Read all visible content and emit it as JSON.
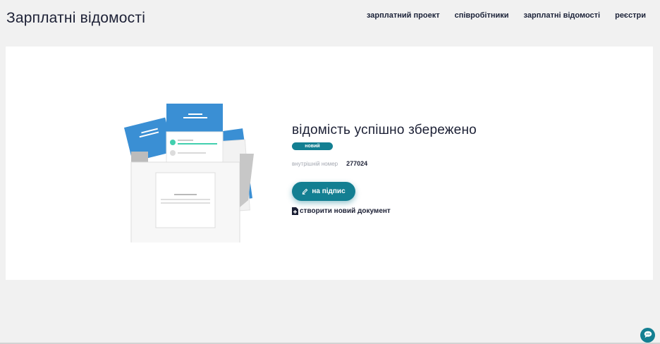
{
  "header": {
    "title": "Зарплатні відомості",
    "nav": [
      {
        "label": "зарплатний проект"
      },
      {
        "label": "співробітники"
      },
      {
        "label": "зарплатні відомості"
      },
      {
        "label": "реєстри"
      }
    ]
  },
  "main": {
    "success_title": "відомість успішно збережено",
    "status_badge": "новий",
    "internal_number_label": "внутрішній номер",
    "internal_number_value": "277024",
    "sign_button_label": "на підпис",
    "create_document_label": "створити новий документ"
  },
  "icons": {
    "sign": "pen-icon",
    "create": "document-plus-icon",
    "chat": "chat-icon",
    "illustration": "documents-illustration"
  },
  "colors": {
    "accent": "#137f92",
    "doc_blue": "#3a8fd4",
    "background": "#f1f1f1",
    "card": "#ffffff"
  }
}
